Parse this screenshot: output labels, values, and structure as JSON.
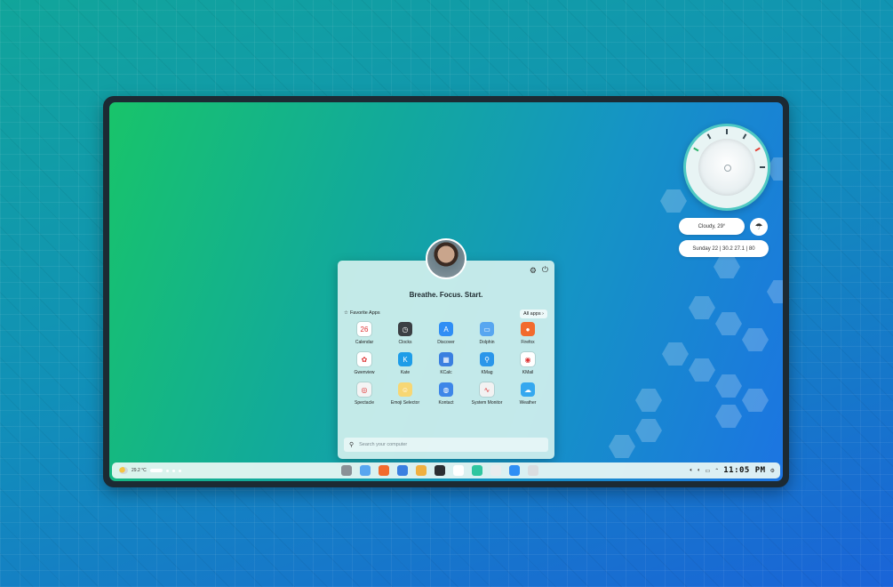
{
  "launcher": {
    "tagline": "Breathe. Focus. Start.",
    "favorites_label": "Favorite Apps",
    "all_apps_label": "All apps",
    "search_placeholder": "Search your computer",
    "apps": [
      {
        "label": "Calendar",
        "icon": "calendar-icon",
        "color": "#ffffff",
        "glyph": "26"
      },
      {
        "label": "Clocks",
        "icon": "clock-icon",
        "color": "#3b3f43",
        "glyph": "◷"
      },
      {
        "label": "Discover",
        "icon": "discover-icon",
        "color": "#2f8ef5",
        "glyph": "A"
      },
      {
        "label": "Dolphin",
        "icon": "folder-icon",
        "color": "#58a6f0",
        "glyph": "▭"
      },
      {
        "label": "Firefox",
        "icon": "firefox-icon",
        "color": "#f26b2d",
        "glyph": "●"
      },
      {
        "label": "Gwenview",
        "icon": "gwenview-icon",
        "color": "#ffffff",
        "glyph": "✿"
      },
      {
        "label": "Kate",
        "icon": "kate-icon",
        "color": "#1e9de8",
        "glyph": "K"
      },
      {
        "label": "KCalc",
        "icon": "kcalc-icon",
        "color": "#3a7fe0",
        "glyph": "▦"
      },
      {
        "label": "KMag",
        "icon": "kmag-icon",
        "color": "#2a96ea",
        "glyph": "⚲"
      },
      {
        "label": "KMail",
        "icon": "kmail-icon",
        "color": "#ffffff",
        "glyph": "◉"
      },
      {
        "label": "Spectacle",
        "icon": "spectacle-icon",
        "color": "#f4f4f4",
        "glyph": "◎"
      },
      {
        "label": "Emoji Selector",
        "icon": "emoji-icon",
        "color": "#f7d774",
        "glyph": "☺"
      },
      {
        "label": "Kontact",
        "icon": "kontact-icon",
        "color": "#3d86e8",
        "glyph": "◍"
      },
      {
        "label": "System Monitor",
        "icon": "system-monitor-icon",
        "color": "#f2f2f2",
        "glyph": "∿"
      },
      {
        "label": "Weather",
        "icon": "weather-icon",
        "color": "#35a8ef",
        "glyph": "☁"
      }
    ]
  },
  "widgets": {
    "weather_pill": "Cloudy, 29°",
    "date_pill": "Sunday 22 | 30.2 27.1 | 80"
  },
  "taskbar": {
    "temperature": "29.2 °C",
    "time": "11:05 PM",
    "apps": [
      {
        "icon": "user-group-icon",
        "color": "#8a9096"
      },
      {
        "icon": "folder-icon",
        "color": "#58a6f0"
      },
      {
        "icon": "firefox-icon",
        "color": "#f26b2d"
      },
      {
        "icon": "kcalc-icon",
        "color": "#3a7fe0"
      },
      {
        "icon": "gwenview-icon",
        "color": "#f0b040"
      },
      {
        "icon": "terminal-icon",
        "color": "#2b2f33"
      },
      {
        "icon": "calendar-icon",
        "color": "#ffffff"
      },
      {
        "icon": "music-icon",
        "color": "#2fc6a0"
      },
      {
        "icon": "notes-icon",
        "color": "#e9ecee"
      },
      {
        "icon": "discover-icon",
        "color": "#2f8ef5"
      },
      {
        "icon": "settings-app-icon",
        "color": "#d9dde0"
      }
    ]
  }
}
